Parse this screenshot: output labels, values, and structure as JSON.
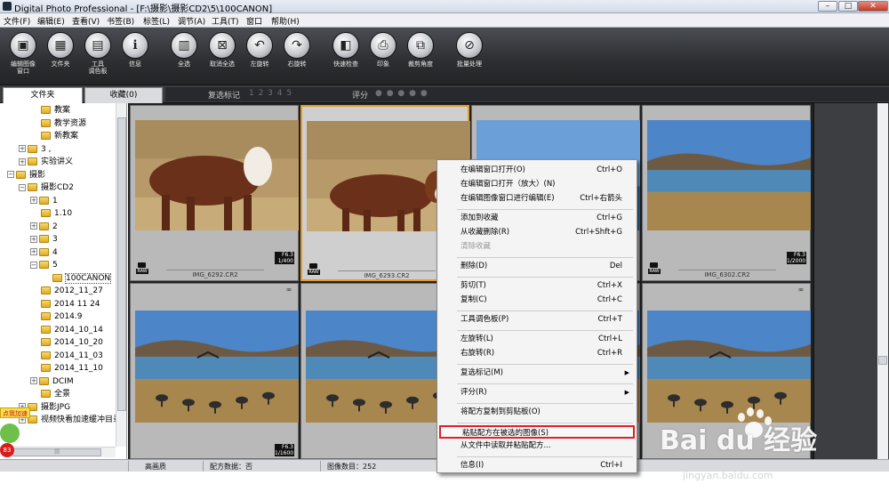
{
  "window": {
    "title": "Digital Photo Professional - [F:\\摄影\\摄影CD2\\5\\100CANON]"
  },
  "menubar": [
    "文件(F)",
    "编辑(E)",
    "查看(V)",
    "书签(B)",
    "标签(L)",
    "调节(A)",
    "工具(T)",
    "窗口",
    "帮助(H)"
  ],
  "toolbar": [
    {
      "label": "编辑图像\n窗口",
      "icon": "edit-window-icon",
      "glyph": "▣"
    },
    {
      "label": "文件夹",
      "icon": "folder-icon",
      "glyph": "▦"
    },
    {
      "label": "工具\n调色板",
      "icon": "tool-palette-icon",
      "glyph": "▤"
    },
    {
      "label": "信息",
      "icon": "info-icon",
      "glyph": "ℹ"
    },
    {
      "label": "全选",
      "icon": "select-all-icon",
      "glyph": "▥"
    },
    {
      "label": "取消全选",
      "icon": "deselect-all-icon",
      "glyph": "⊠"
    },
    {
      "label": "左旋转",
      "icon": "rotate-left-icon",
      "glyph": "↶"
    },
    {
      "label": "右旋转",
      "icon": "rotate-right-icon",
      "glyph": "↷"
    },
    {
      "label": "快速检查",
      "icon": "quick-check-icon",
      "glyph": "◧"
    },
    {
      "label": "印象",
      "icon": "print-icon",
      "glyph": "⎙"
    },
    {
      "label": "裁剪角度",
      "icon": "crop-angle-icon",
      "glyph": "⧉"
    },
    {
      "label": "批量处理",
      "icon": "batch-process-icon",
      "glyph": "⊘"
    }
  ],
  "tabs": {
    "folder": "文件夹",
    "favorites": "收藏(0)",
    "check_mark_label": "复选标记",
    "check_mark_values": "1 2 3 4 5",
    "rating_label": "评分",
    "rating_values": "● ● ● ● ●"
  },
  "tree": [
    {
      "label": "教案",
      "indent": 2,
      "expander": ""
    },
    {
      "label": "教学资源",
      "indent": 2,
      "expander": ""
    },
    {
      "label": "新教案",
      "indent": 2,
      "expander": ""
    },
    {
      "label": "3 ,",
      "indent": 1,
      "expander": "+"
    },
    {
      "label": "实验讲义",
      "indent": 1,
      "expander": "+"
    },
    {
      "label": "摄影",
      "indent": 0,
      "expander": "−"
    },
    {
      "label": "摄影CD2",
      "indent": 1,
      "expander": "−"
    },
    {
      "label": "1",
      "indent": 2,
      "expander": "+"
    },
    {
      "label": "1.10",
      "indent": 2,
      "expander": ""
    },
    {
      "label": "2",
      "indent": 2,
      "expander": "+"
    },
    {
      "label": "3",
      "indent": 2,
      "expander": "+"
    },
    {
      "label": "4",
      "indent": 2,
      "expander": "+"
    },
    {
      "label": "5",
      "indent": 2,
      "expander": "−"
    },
    {
      "label": "100CANON",
      "indent": 3,
      "expander": "",
      "selected": true
    },
    {
      "label": "2012_11_27",
      "indent": 2,
      "expander": ""
    },
    {
      "label": "2014 11 24",
      "indent": 2,
      "expander": ""
    },
    {
      "label": "2014.9",
      "indent": 2,
      "expander": ""
    },
    {
      "label": "2014_10_14",
      "indent": 2,
      "expander": ""
    },
    {
      "label": "2014_10_20",
      "indent": 2,
      "expander": ""
    },
    {
      "label": "2014_11_03",
      "indent": 2,
      "expander": ""
    },
    {
      "label": "2014_11_10",
      "indent": 2,
      "expander": ""
    },
    {
      "label": "DCIM",
      "indent": 2,
      "expander": "+"
    },
    {
      "label": "全景",
      "indent": 2,
      "expander": ""
    },
    {
      "label": "摄影JPG",
      "indent": 1,
      "expander": "+"
    },
    {
      "label": "视频快看加速缓冲目录",
      "indent": 1,
      "expander": "+"
    }
  ],
  "badge": {
    "top_text": "点我加速",
    "number": "83"
  },
  "thumbnails": [
    {
      "file": "IMG_6292.CR2",
      "aperture": "F6.3",
      "shutter": "1/400",
      "scene": "cow-left",
      "raw": "RAW"
    },
    {
      "file": "IMG_6293.CR2",
      "aperture": "",
      "shutter": "",
      "scene": "cow-right",
      "raw": "RAW",
      "selected": true
    },
    {
      "file": "",
      "aperture": "",
      "shutter": "",
      "scene": "lake-sky",
      "raw": ""
    },
    {
      "file": "IMG_6302.CR2",
      "aperture": "F6.3",
      "shutter": "1/2000",
      "scene": "lake",
      "raw": "RAW"
    },
    {
      "file": "",
      "aperture": "F6.3",
      "shutter": "1/1600",
      "scene": "cranes",
      "raw": ""
    },
    {
      "file": "",
      "aperture": "",
      "shutter": "",
      "scene": "cranes",
      "raw": ""
    },
    {
      "file": "",
      "aperture": "",
      "shutter": "",
      "scene": "cranes",
      "raw": ""
    },
    {
      "file": "",
      "aperture": "",
      "shutter": "",
      "scene": "cranes-lake",
      "raw": ""
    }
  ],
  "thumb_chain_glyph": "∞",
  "context_menu": [
    {
      "label": "在编辑窗口打开(O)",
      "shortcut": "Ctrl+O"
    },
    {
      "label": "在编辑窗口打开（放大）(N)",
      "shortcut": ""
    },
    {
      "label": "在编辑图像窗口进行编辑(E)",
      "shortcut": "Ctrl+右箭头"
    },
    {
      "sep": true
    },
    {
      "label": "添加到收藏",
      "shortcut": "Ctrl+G"
    },
    {
      "label": "从收藏删除(R)",
      "shortcut": "Ctrl+Shft+G"
    },
    {
      "label": "清除收藏",
      "shortcut": "",
      "disabled": true
    },
    {
      "sep": true
    },
    {
      "label": "删除(D)",
      "shortcut": "Del"
    },
    {
      "sep": true
    },
    {
      "label": "剪切(T)",
      "shortcut": "Ctrl+X"
    },
    {
      "label": "复制(C)",
      "shortcut": "Ctrl+C"
    },
    {
      "sep": true
    },
    {
      "label": "工具调色板(P)",
      "shortcut": "Ctrl+T"
    },
    {
      "sep": true
    },
    {
      "label": "左旋转(L)",
      "shortcut": "Ctrl+L"
    },
    {
      "label": "右旋转(R)",
      "shortcut": "Ctrl+R"
    },
    {
      "sep": true
    },
    {
      "label": "复选标记(M)",
      "shortcut": "",
      "submenu": true
    },
    {
      "sep": true
    },
    {
      "label": "评分(R)",
      "shortcut": "",
      "submenu": true
    },
    {
      "sep": true
    },
    {
      "label": "将配方复制到剪贴板(O)",
      "shortcut": ""
    },
    {
      "sep": true
    },
    {
      "label": "粘贴配方在被选的图像(S)",
      "shortcut": "",
      "highlighted": true
    },
    {
      "label": "从文件中读取并粘贴配方...",
      "shortcut": ""
    },
    {
      "sep": true
    },
    {
      "label": "信息(I)",
      "shortcut": "Ctrl+I"
    }
  ],
  "statusbar": {
    "quality": "高画质",
    "recipe": "配方数据：否",
    "image_count": "图像数目：252"
  },
  "watermark": {
    "main": "Bai  du 经验",
    "sub": "jingyan.baidu.com"
  },
  "colors": {
    "selection_border": "#e39b2a",
    "menu_highlight_border": "#e0202a"
  }
}
